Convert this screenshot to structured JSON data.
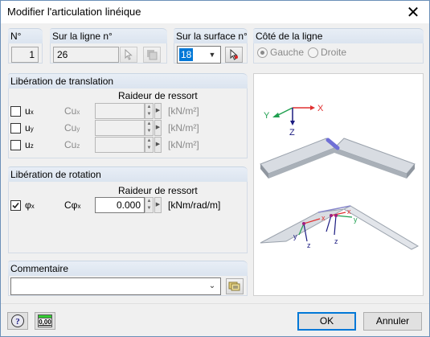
{
  "window": {
    "title": "Modifier l'articulation linéique",
    "close": "✕"
  },
  "numero": {
    "label": "N°",
    "value": "1"
  },
  "ligne": {
    "label": "Sur la ligne n°",
    "value": "26"
  },
  "surface": {
    "label": "Sur la surface n°",
    "value": "18"
  },
  "cote": {
    "label": "Côté de la ligne",
    "gauche": "Gauche",
    "droite": "Droite",
    "selected": "Gauche"
  },
  "translation": {
    "header": "Libération de translation",
    "subheader": "Raideur de ressort",
    "rows": [
      {
        "check": "u",
        "sub": "x",
        "c": "Cu",
        "csub": "x",
        "unit": "[kN/m²]"
      },
      {
        "check": "u",
        "sub": "y",
        "c": "Cu",
        "csub": "y",
        "unit": "[kN/m²]"
      },
      {
        "check": "u",
        "sub": "z",
        "c": "Cu",
        "csub": "z",
        "unit": "[kN/m²]"
      }
    ]
  },
  "rotation": {
    "header": "Libération de rotation",
    "subheader": "Raideur de ressort",
    "check": "φ",
    "sub": "x",
    "checked": true,
    "c": "Cφ",
    "csub": "x",
    "value": "0.000",
    "unit": "[kNm/rad/m]"
  },
  "commentaire": {
    "label": "Commentaire",
    "value": ""
  },
  "buttons": {
    "ok": "OK",
    "cancel": "Annuler",
    "units": "0,00"
  },
  "preview": {
    "axis_x": "X",
    "axis_y": "Y",
    "axis_z": "Z",
    "x": "x",
    "y": "y",
    "z": "z"
  },
  "colors": {
    "accent": "#0078d7",
    "header_bg": "#dbe4ef",
    "hinge": "#6f6fd6"
  },
  "icons": [
    "close-icon",
    "pick-icon",
    "select-icon",
    "help-icon",
    "units-icon",
    "comment-library-icon"
  ]
}
